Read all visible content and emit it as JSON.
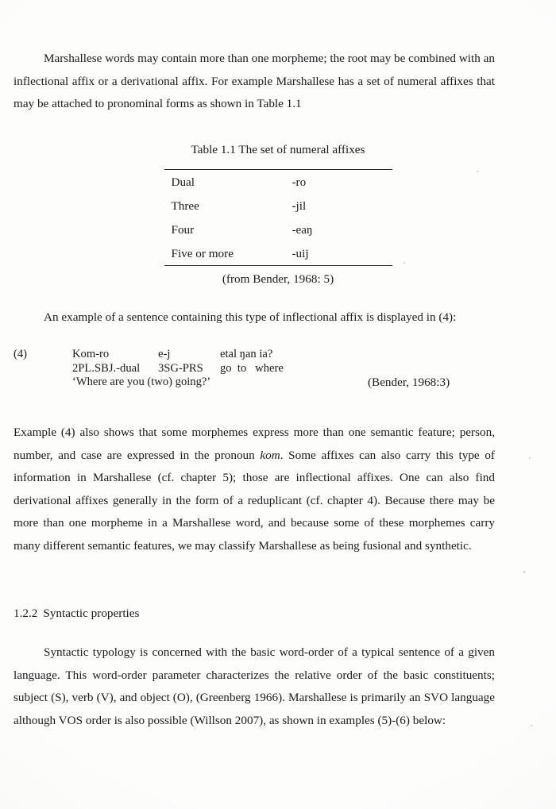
{
  "document": {
    "paragraph_1": "Marshallese words may contain more than one morpheme; the root may be combined with an inflectional affix or a derivational affix. For example Marshallese has a set of numeral affixes that may be attached to pronominal forms as shown in Table 1.1",
    "paragraph_2": "An example of a sentence containing this type of inflectional affix is displayed in (4):",
    "paragraph_3_part_1": "Example (4) also shows that some morphemes express more than one semantic feature; person, number, and case are expressed in the pronoun ",
    "paragraph_3_italic": "kom",
    "paragraph_3_part_2": ". Some affixes can also carry this type of information in Marshallese (cf. chapter 5); those are inflectional affixes. One can also find derivational affixes generally in the form of a reduplicant (cf. chapter 4). Because there may be more than one morpheme in a Marshallese word, and because some of these morphemes carry many different semantic features, we may classify Marshallese as being fusional and synthetic.",
    "paragraph_4": "Syntactic typology is concerned with the basic word-order of a typical sentence of a given language. This word-order parameter characterizes the relative order of the basic constituents; subject (S), verb (V), and object (O), (Greenberg 1966).   Marshallese is primarily an SVO language although VOS order is also possible (Willson 2007), as shown in examples (5)-(6) below:"
  },
  "table": {
    "caption": "Table 1.1 The set of numeral affixes",
    "rows": [
      {
        "label": "Dual",
        "affix": "-ro"
      },
      {
        "label": "Three",
        "affix": "-jil"
      },
      {
        "label": "Four",
        "affix": "-eaŋ"
      },
      {
        "label": "Five or more",
        "affix": "-uij"
      }
    ],
    "source": "(from Bender, 1968: 5)"
  },
  "example_4": {
    "number": "(4)",
    "line_object": {
      "seg_1": "Kom-ro",
      "seg_2": "e-j",
      "seg_3": "etal ŋan ia?"
    },
    "line_gloss": {
      "seg_1_sc": "2PL.SBJ.",
      "seg_1_rest": "-dual",
      "seg_2_sc": "3SG-PRS",
      "seg_3": "go  to   where"
    },
    "line_translation": "‘Where are you (two) going?’",
    "citation": "(Bender, 1968:3)"
  },
  "section": {
    "number": "1.2.2",
    "title": "Syntactic properties"
  }
}
